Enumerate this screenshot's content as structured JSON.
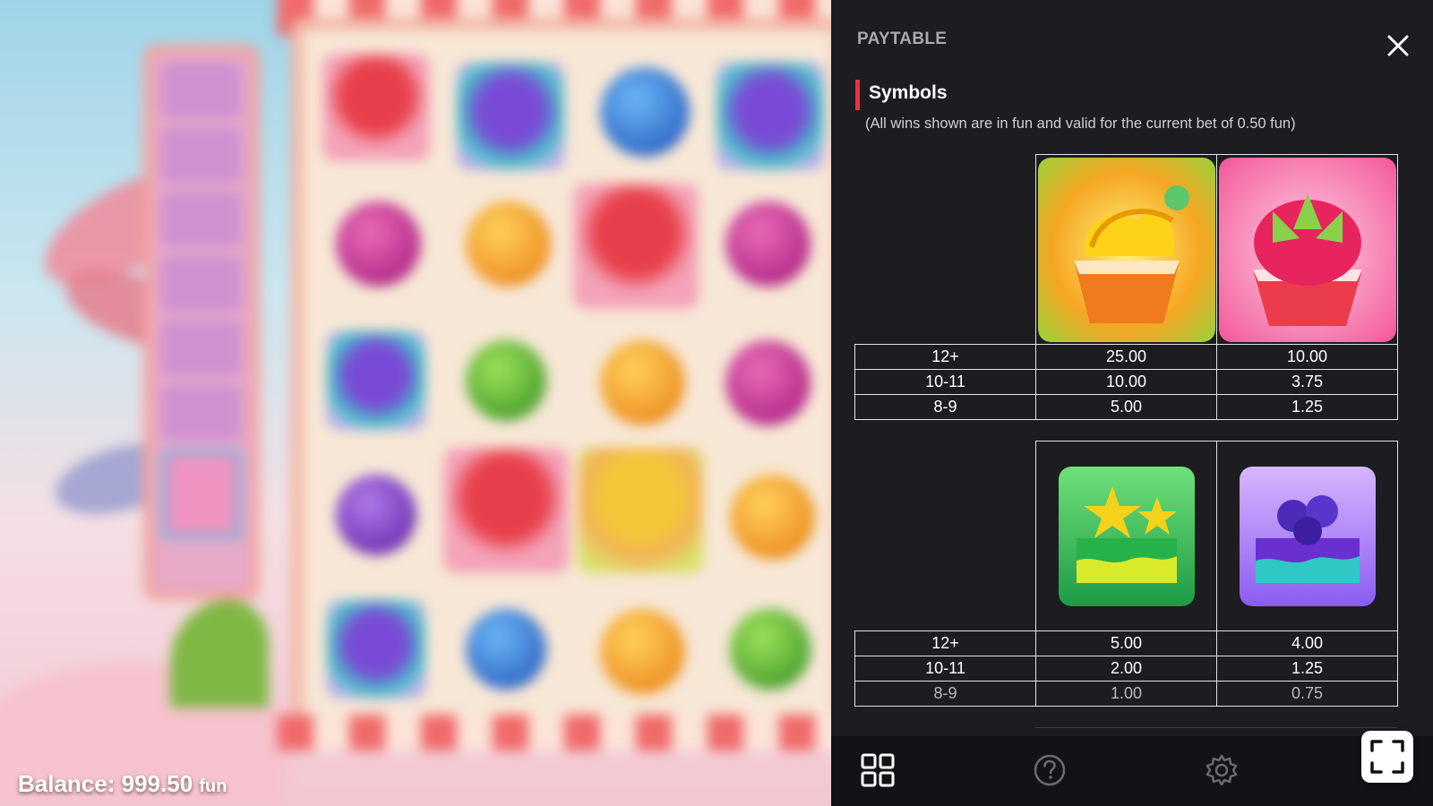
{
  "game": {
    "balance_label": "Balance:",
    "balance_value": "999.50",
    "balance_unit": "fun"
  },
  "panel": {
    "title": "PAYTABLE",
    "close_icon": "close-icon",
    "section_title": "Symbols",
    "section_note": "(All wins shown are in fun and valid for the current bet of 0.50 fun)",
    "accent_color": "#e8323c"
  },
  "tables": [
    {
      "symbols": [
        "banana-cupcake-icon",
        "dragonfruit-cupcake-icon"
      ],
      "rows": [
        {
          "count": "12+",
          "values": [
            "25.00",
            "10.00"
          ]
        },
        {
          "count": "10-11",
          "values": [
            "10.00",
            "3.75"
          ]
        },
        {
          "count": "8-9",
          "values": [
            "5.00",
            "1.25"
          ]
        }
      ]
    },
    {
      "symbols": [
        "starfruit-cake-icon",
        "blueberry-cake-icon"
      ],
      "rows": [
        {
          "count": "12+",
          "values": [
            "5.00",
            "4.00"
          ]
        },
        {
          "count": "10-11",
          "values": [
            "2.00",
            "1.25"
          ]
        },
        {
          "count": "8-9",
          "values": [
            "1.00",
            "0.75"
          ]
        }
      ]
    }
  ],
  "bottom_bar": {
    "icons": [
      "menu-grid-icon",
      "help-icon",
      "settings-icon",
      "fullscreen-icon"
    ]
  }
}
